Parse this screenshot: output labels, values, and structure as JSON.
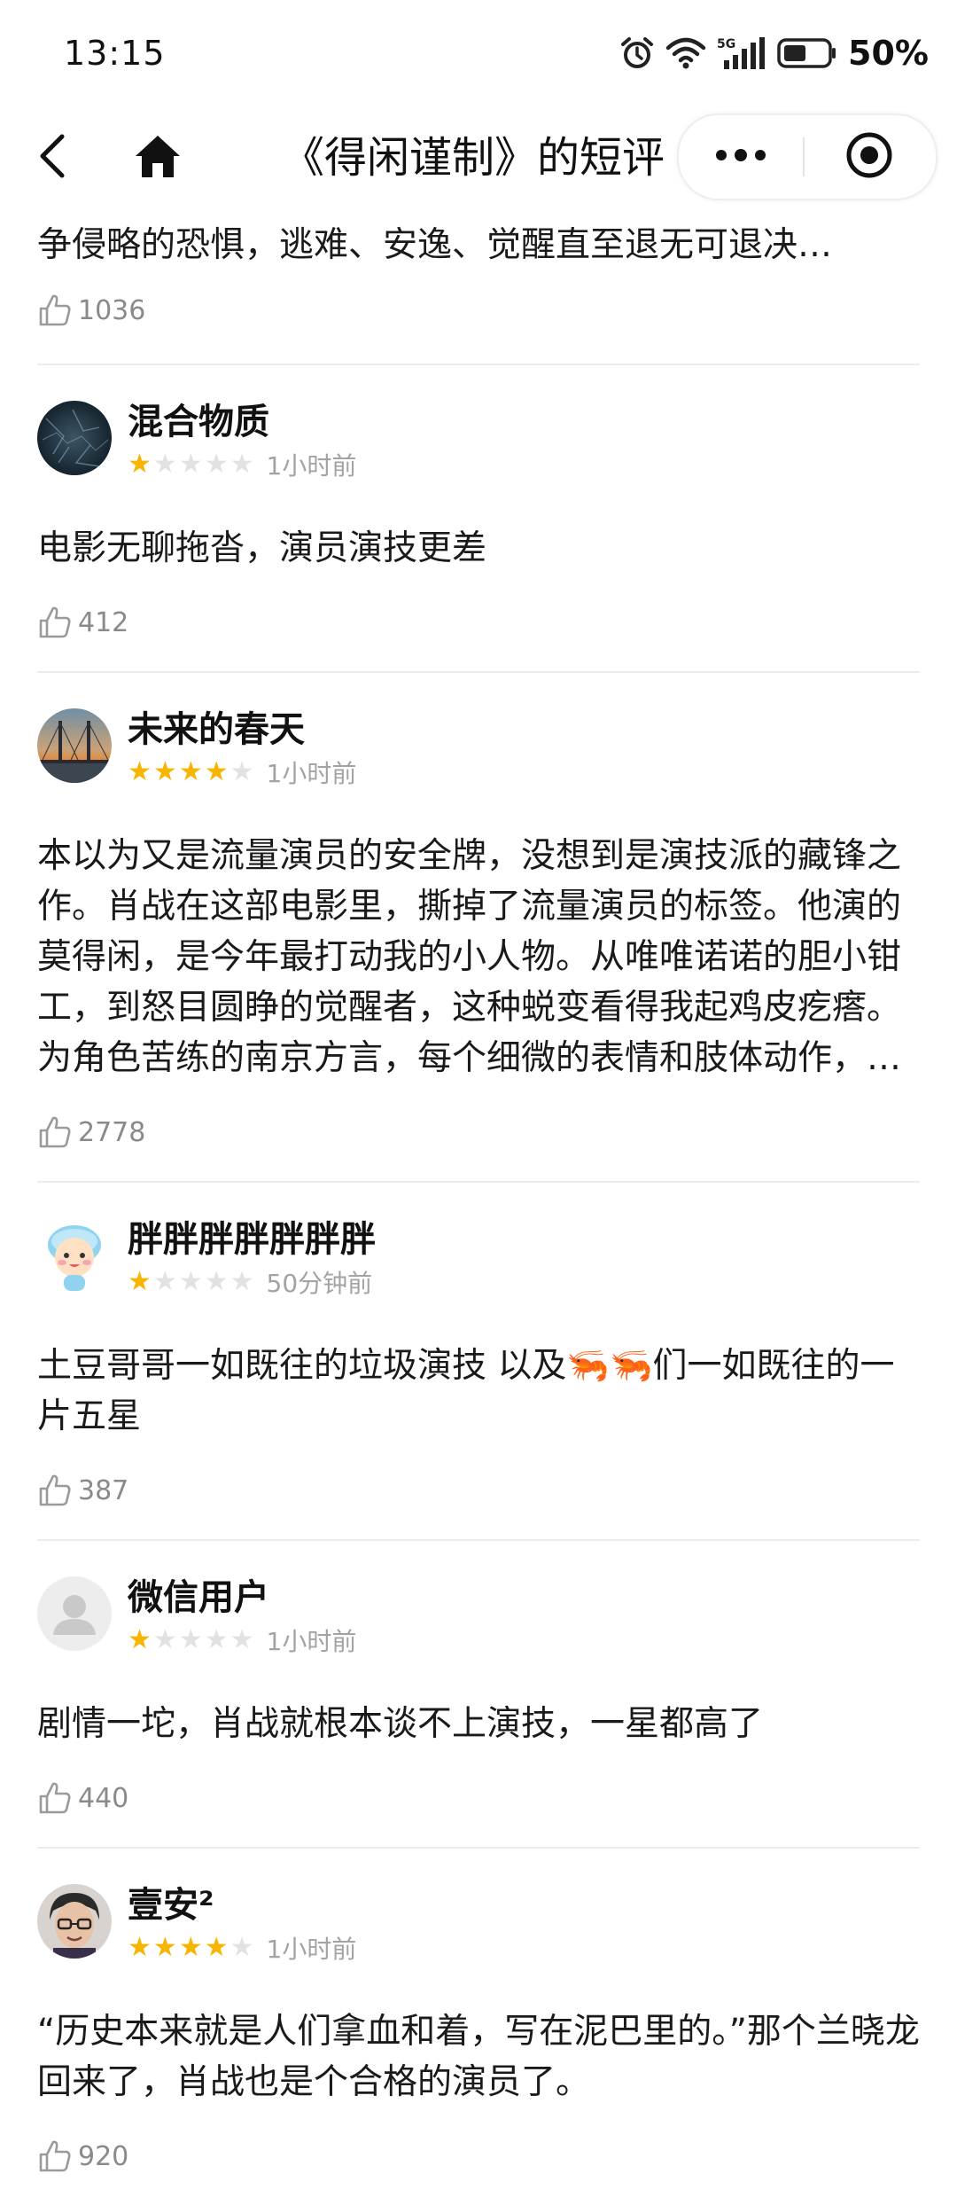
{
  "status": {
    "time": "13:15",
    "network": "5G",
    "battery": "50%"
  },
  "nav": {
    "title": "《得闲谨制》的短评"
  },
  "reviews": [
    {
      "partial": true,
      "text": "争侵略的恐惧，逃难、安逸、觉醒直至退无可退决…",
      "likes": "1036"
    },
    {
      "name": "混合物质",
      "rating": 1,
      "time": "1小时前",
      "text": "电影无聊拖沓，演员演技更差",
      "likes": "412",
      "avatar": "dark-texture"
    },
    {
      "name": "未来的春天",
      "rating": 4,
      "time": "1小时前",
      "text": "本以为又是流量演员的安全牌，没想到是演技派的藏锋之作。肖战在这部电影里，撕掉了流量演员的标签。他演的莫得闲，是今年最打动我的小人物。从唯唯诺诺的胆小钳工，到怒目圆睁的觉醒者，这种蜕变看得我起鸡皮疙瘩。为角色苦练的南京方言，每个细微的表情和肢体动作，把小人物的恐惧和觉醒全演…",
      "likes": "2778",
      "avatar": "bridge-sunset"
    },
    {
      "name": "胖胖胖胖胖胖胖",
      "rating": 1,
      "time": "50分钟前",
      "text": "土豆哥哥一如既往的垃圾演技 以及🦐🦐们一如既往的一片五星",
      "likes": "387",
      "avatar": "cartoon-kid"
    },
    {
      "name": "微信用户",
      "rating": 1,
      "time": "1小时前",
      "text": "剧情一坨，肖战就根本谈不上演技，一星都高了",
      "likes": "440",
      "avatar": "default-user"
    },
    {
      "name": "壹安²",
      "rating": 4,
      "time": "1小时前",
      "text": "“历史本来就是人们拿血和着，写在泥巴里的。”那个兰晓龙回来了，肖战也是个合格的演员了。",
      "likes": "920",
      "avatar": "man-glasses"
    }
  ],
  "colors": {
    "star_on": "#f7b500",
    "star_off": "#e2e2e2",
    "meta_text": "#a3a3a3",
    "divider": "#ececec"
  }
}
